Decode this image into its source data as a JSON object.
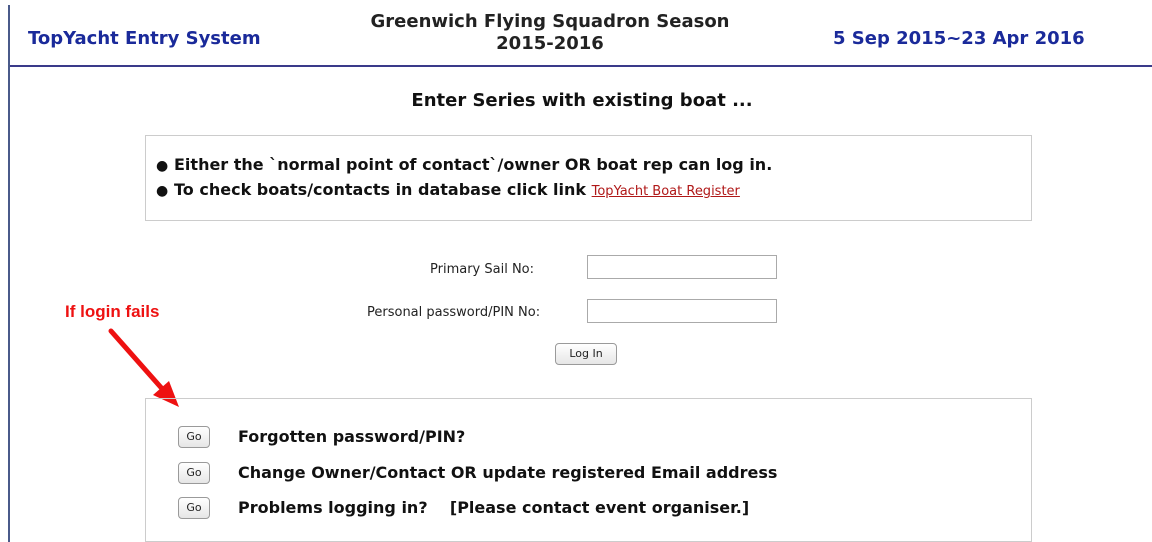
{
  "header": {
    "system_name": "TopYacht Entry System",
    "event_title_line1": "Greenwich Flying Squadron Season",
    "event_title_line2": "2015-2016",
    "date_range": "5 Sep 2015~23 Apr 2016"
  },
  "page": {
    "subtitle": "Enter Series with existing boat ..."
  },
  "info": {
    "bullet1": "Either the `normal point of contact`/owner OR boat rep can log in.",
    "bullet2_text": "To check boats/contacts in database click link ",
    "bullet2_link": "TopYacht Boat Register"
  },
  "login": {
    "sail_label": "Primary Sail No:",
    "sail_value": "",
    "pin_label": "Personal password/PIN No:",
    "pin_value": "",
    "button": "Log In"
  },
  "annotation": {
    "text": "If login fails",
    "color": "#ee1111"
  },
  "options": [
    {
      "button": "Go",
      "label": "Forgotten password/PIN?"
    },
    {
      "button": "Go",
      "label": "Change Owner/Contact OR update registered Email address"
    },
    {
      "button": "Go",
      "label": "Problems logging in?    [Please contact event organiser.]"
    }
  ],
  "colors": {
    "header_text": "#1a2a9a",
    "link": "#b01818"
  }
}
